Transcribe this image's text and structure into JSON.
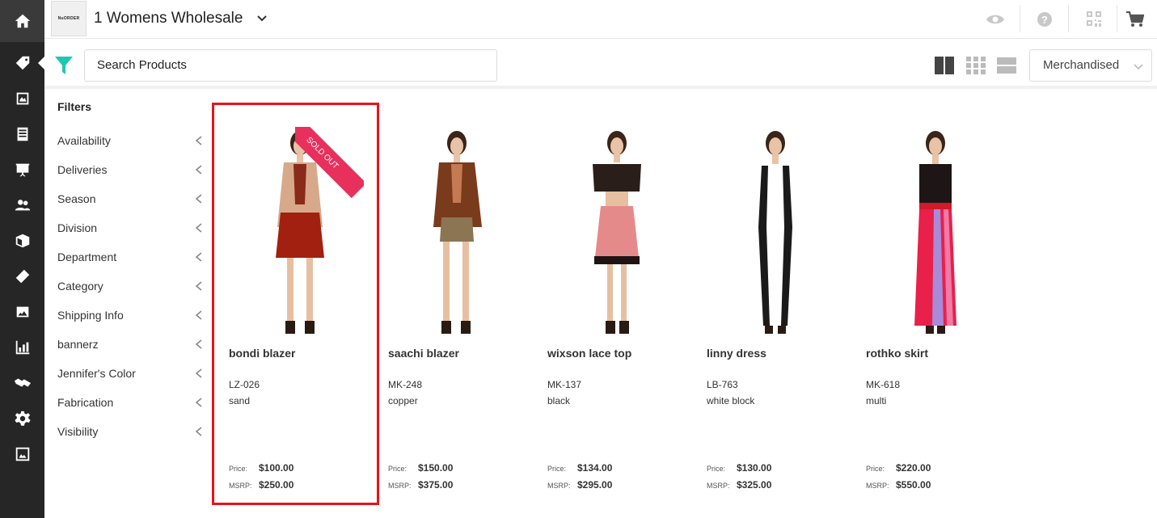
{
  "colors": {
    "accent": "#1fc7b0",
    "sidebar": "#262626",
    "sold_out": "#e8305d",
    "highlight": "#e8121b"
  },
  "sidebar": {
    "items": [
      {
        "icon": "home-icon"
      },
      {
        "icon": "tag-icon"
      },
      {
        "icon": "catalog-icon"
      },
      {
        "icon": "linesheet-icon"
      },
      {
        "icon": "presentation-icon"
      },
      {
        "icon": "customers-icon"
      },
      {
        "icon": "box-icon"
      },
      {
        "icon": "tickets-icon"
      },
      {
        "icon": "image-icon"
      },
      {
        "icon": "analytics-icon"
      },
      {
        "icon": "handshake-icon"
      },
      {
        "icon": "gear-icon"
      },
      {
        "icon": "image-export-icon"
      }
    ]
  },
  "header": {
    "logo_text": "NuORDER",
    "title": "1 Womens Wholesale",
    "icons": [
      "eye-icon",
      "help-icon",
      "qr-icon",
      "cart-icon"
    ]
  },
  "toolbar": {
    "search_placeholder": "Search Products",
    "views": [
      "grid-large-icon",
      "grid-small-icon",
      "list-icon"
    ],
    "sort": "Merchandised"
  },
  "filters": {
    "title": "Filters",
    "items": [
      "Availability",
      "Deliveries",
      "Season",
      "Division",
      "Department",
      "Category",
      "Shipping Info",
      "bannerz",
      "Jennifer's Color",
      "Fabrication",
      "Visibility"
    ]
  },
  "products": [
    {
      "name": "bondi blazer",
      "sku": "LZ-026",
      "color": "sand",
      "price": "$100.00",
      "msrp": "$250.00",
      "badge": "SOLD OUT",
      "price_label": "Price:",
      "msrp_label": "MSRP:"
    },
    {
      "name": "saachi blazer",
      "sku": "MK-248",
      "color": "copper",
      "price": "$150.00",
      "msrp": "$375.00",
      "price_label": "Price:",
      "msrp_label": "MSRP:"
    },
    {
      "name": "wixson lace top",
      "sku": "MK-137",
      "color": "black",
      "price": "$134.00",
      "msrp": "$295.00",
      "price_label": "Price:",
      "msrp_label": "MSRP:"
    },
    {
      "name": "linny dress",
      "sku": "LB-763",
      "color": "white block",
      "price": "$130.00",
      "msrp": "$325.00",
      "price_label": "Price:",
      "msrp_label": "MSRP:"
    },
    {
      "name": "rothko skirt",
      "sku": "MK-618",
      "color": "multi",
      "price": "$220.00",
      "msrp": "$550.00",
      "price_label": "Price:",
      "msrp_label": "MSRP:"
    }
  ]
}
